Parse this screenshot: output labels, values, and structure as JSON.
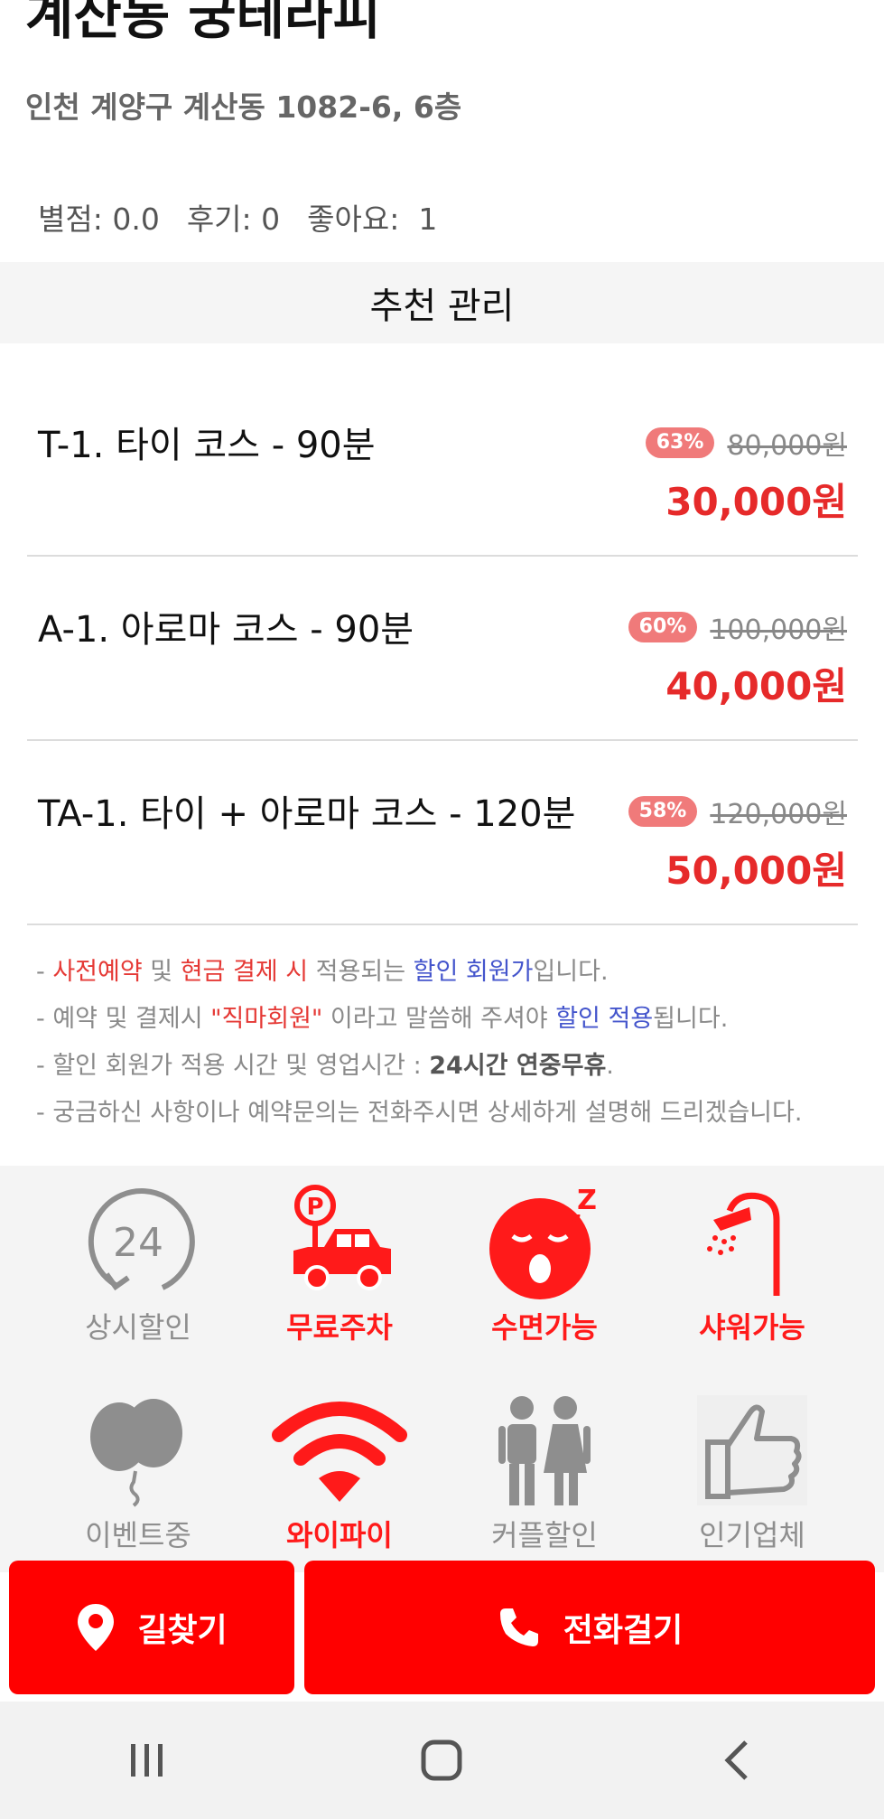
{
  "shop": {
    "title": "계산동 궁테라피",
    "address": "인천 계양구 계산동 1082-6, 6층"
  },
  "stats": {
    "rating": "별점: 0.0",
    "reviews": "후기: 0",
    "likes": "좋아요:  1"
  },
  "section_title": "추천 관리",
  "courses": [
    {
      "name": "T-1. 타이 코스 - 90분",
      "discount": "63%",
      "original_price": "80,000원",
      "sale_price": "30,000원"
    },
    {
      "name": "A-1. 아로마 코스 - 90분",
      "discount": "60%",
      "original_price": "100,000원",
      "sale_price": "40,000원"
    },
    {
      "name": "TA-1. 타이 + 아로마 코스 - 120분",
      "discount": "58%",
      "original_price": "120,000원",
      "sale_price": "50,000원"
    }
  ],
  "notes": {
    "line1": {
      "a": "- ",
      "b": "사전예약",
      "c": " 및 ",
      "d": "현금 결제 시",
      "e": " 적용되는 ",
      "f": "할인 회원가",
      "g": "입니다."
    },
    "line2": {
      "a": "- 예약 및 결제시 ",
      "b": "\"직마회원\"",
      "c": " 이라고 말씀해 주셔야 ",
      "d": "할인 적용",
      "e": "됩니다."
    },
    "line3": {
      "a": "- 할인 회원가 적용 시간 및 영업시간 : ",
      "b": "24시간 연중무휴",
      "c": "."
    },
    "line4": "- 궁금하신 사항이나 예약문의는 전화주시면 상세하게 설명해 드리겠습니다."
  },
  "amenities": [
    {
      "label": "상시할인",
      "icon": "24-hour-icon",
      "active": false
    },
    {
      "label": "무료주차",
      "icon": "parking-car-icon",
      "active": true
    },
    {
      "label": "수면가능",
      "icon": "sleeping-face-icon",
      "active": true
    },
    {
      "label": "샤워가능",
      "icon": "shower-icon",
      "active": true
    },
    {
      "label": "이벤트중",
      "icon": "balloons-icon",
      "active": false
    },
    {
      "label": "와이파이",
      "icon": "wifi-icon",
      "active": true
    },
    {
      "label": "커플할인",
      "icon": "couple-icon",
      "active": false
    },
    {
      "label": "인기업체",
      "icon": "thumbs-up-icon",
      "active": false
    }
  ],
  "actions": {
    "directions": "길찾기",
    "call": "전화걸기"
  },
  "colors": {
    "accent_red": "#ff0000",
    "price_red": "#e62a2a",
    "badge": "#f07a7a",
    "link_blue": "#4455cc"
  }
}
